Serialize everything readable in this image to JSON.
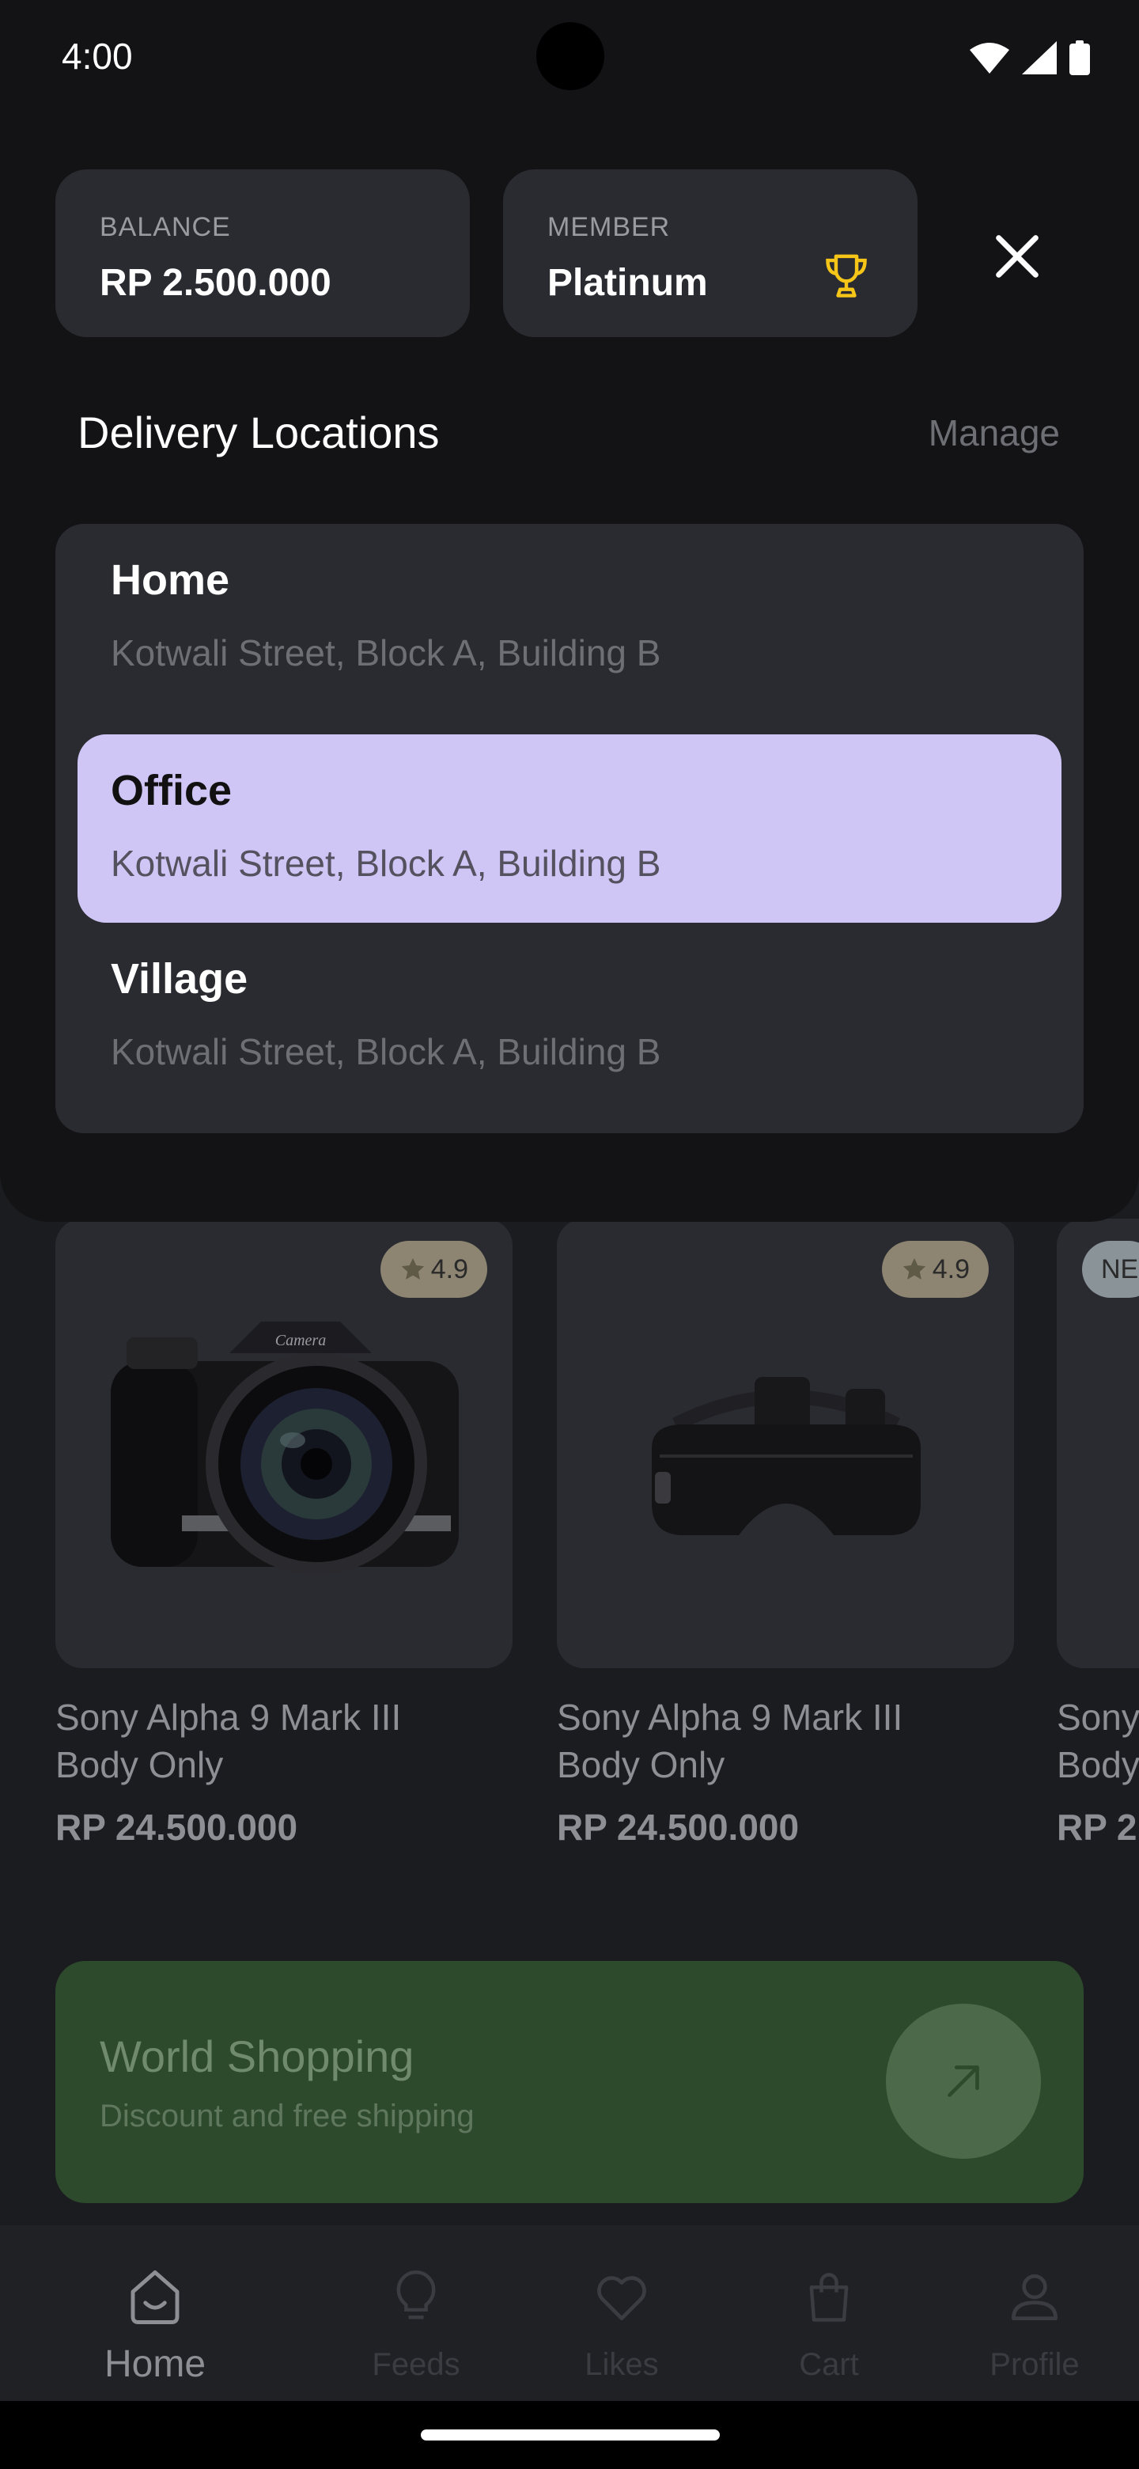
{
  "status_bar": {
    "time": "4:00"
  },
  "balance_card": {
    "label": "BALANCE",
    "value": "RP 2.500.000"
  },
  "member_card": {
    "label": "MEMBER",
    "value": "Platinum"
  },
  "delivery": {
    "title": "Delivery Locations",
    "manage_label": "Manage",
    "locations": [
      {
        "name": "Home",
        "address": "Kotwali Street, Block A, Building B",
        "selected": false
      },
      {
        "name": "Office",
        "address": "Kotwali Street, Block A, Building B",
        "selected": true
      },
      {
        "name": "Village",
        "address": "Kotwali Street, Block A, Building B",
        "selected": false
      }
    ]
  },
  "products": [
    {
      "name_line1": "Sony Alpha 9 Mark III",
      "name_line2": "Body Only",
      "price": "RP 24.500.000",
      "rating": "4.9",
      "image": "camera"
    },
    {
      "name_line1": "Sony Alpha 9 Mark III",
      "name_line2": "Body Only",
      "price": "RP 24.500.000",
      "rating": "4.9",
      "image": "vr-headset"
    },
    {
      "name_line1": "Sony",
      "name_line2": "Body",
      "price": "RP 2",
      "badge": "NE"
    }
  ],
  "camera_brand_text": "Camera",
  "promo": {
    "title": "World Shopping",
    "subtitle": "Discount and free shipping"
  },
  "bottom_nav": {
    "items": [
      {
        "label": "Home",
        "icon": "home-smile-icon",
        "active": true
      },
      {
        "label": "Feeds",
        "icon": "lightbulb-icon",
        "active": false
      },
      {
        "label": "Likes",
        "icon": "heart-icon",
        "active": false
      },
      {
        "label": "Cart",
        "icon": "shopping-bag-icon",
        "active": false
      },
      {
        "label": "Profile",
        "icon": "user-icon",
        "active": false
      }
    ]
  },
  "colors": {
    "accent_selected": "#cfc6f6",
    "trophy": "#f5c518",
    "promo_bg": "#2e4a2d",
    "sheet_bg": "#131316",
    "card_bg": "#2a2b30"
  }
}
